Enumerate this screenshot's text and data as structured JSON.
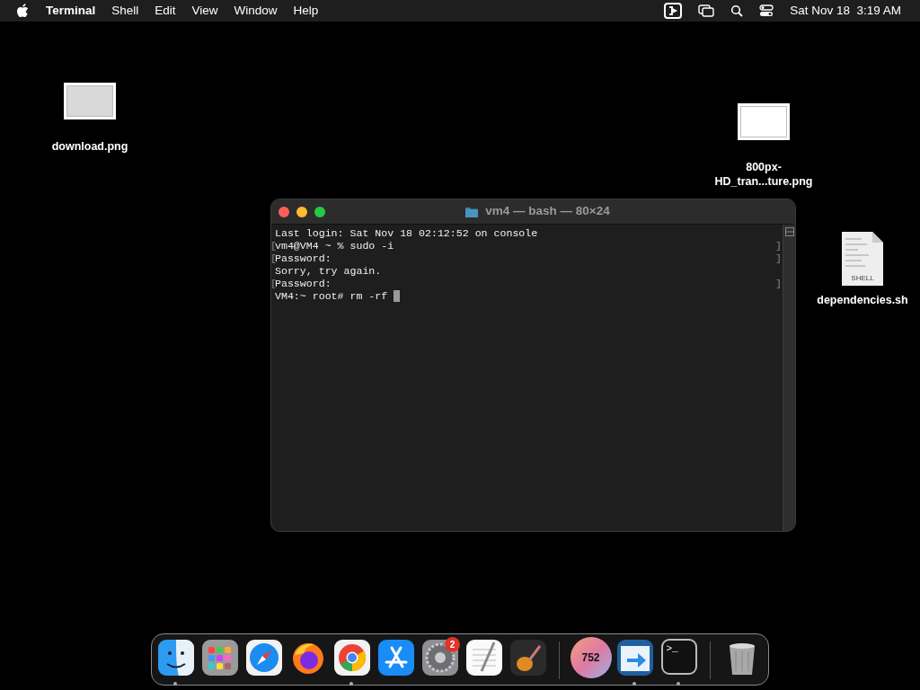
{
  "menu_bar": {
    "app_name": "Terminal",
    "menus": [
      "Shell",
      "Edit",
      "View",
      "Window",
      "Help"
    ],
    "clock": "Sat Nov 18  3:19 AM"
  },
  "desktop_icons": [
    {
      "kind": "image",
      "label_lines": [
        "download.png"
      ]
    },
    {
      "kind": "image",
      "label_lines": [
        "800px-",
        "HD_tran...ture.png"
      ]
    },
    {
      "kind": "script",
      "label_lines": [
        "dependencies.sh"
      ],
      "tag": "SHELL"
    }
  ],
  "terminal": {
    "title": "vm4 — bash — 80×24",
    "lines": [
      {
        "text": "Last login: Sat Nov 18 02:12:52 on console",
        "marked": false,
        "cursor": false
      },
      {
        "text": "vm4@VM4 ~ % sudo -i",
        "marked": true,
        "cursor": false
      },
      {
        "text": "Password:",
        "marked": true,
        "cursor": false
      },
      {
        "text": "Sorry, try again.",
        "marked": false,
        "cursor": false
      },
      {
        "text": "Password:",
        "marked": true,
        "cursor": false
      },
      {
        "text": "VM4:~ root# rm -rf ",
        "marked": false,
        "cursor": true
      }
    ],
    "mark_start": "[",
    "mark_end": "]"
  },
  "dock": {
    "items": [
      {
        "kind": "finder",
        "running": true
      },
      {
        "kind": "launchpad",
        "running": false
      },
      {
        "kind": "safari",
        "running": false
      },
      {
        "kind": "firefox",
        "running": false
      },
      {
        "kind": "chrome",
        "running": true
      },
      {
        "kind": "app-store",
        "running": false
      },
      {
        "kind": "settings",
        "running": false,
        "badge": "2"
      },
      {
        "kind": "textedit",
        "running": false
      },
      {
        "kind": "garageband",
        "running": false
      },
      {
        "kind": "separator"
      },
      {
        "kind": "counter",
        "running": false,
        "text": "752"
      },
      {
        "kind": "migration",
        "running": true
      },
      {
        "kind": "terminal",
        "running": true,
        "text": ">_"
      },
      {
        "kind": "separator"
      },
      {
        "kind": "trash",
        "running": false
      }
    ]
  }
}
